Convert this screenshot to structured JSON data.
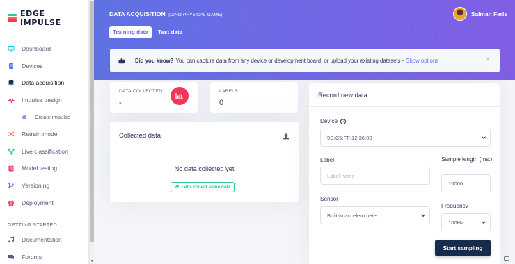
{
  "brand": {
    "name": "EDGE IMPULSE"
  },
  "sidebar": {
    "items": [
      {
        "label": "Dashboard",
        "icon": "monitor-icon",
        "color": "#11cdef"
      },
      {
        "label": "Devices",
        "icon": "devices-icon",
        "color": "#5e72e4"
      },
      {
        "label": "Data acquisition",
        "icon": "database-icon",
        "color": "#172b4d",
        "active": true
      },
      {
        "label": "Impulse design",
        "icon": "pulse-icon",
        "color": "#f5365c"
      },
      {
        "label": "Create impulse",
        "icon": "dot-icon",
        "color": "#5e72e4",
        "sub": true
      },
      {
        "label": "Retrain model",
        "icon": "shuffle-icon",
        "color": "#fb6340"
      },
      {
        "label": "Live classification",
        "icon": "network-icon",
        "color": "#2dce89"
      },
      {
        "label": "Model testing",
        "icon": "clipboard-icon",
        "color": "#f5365c"
      },
      {
        "label": "Versioning",
        "icon": "branch-icon",
        "color": "#5e72e4"
      },
      {
        "label": "Deployment",
        "icon": "gift-icon",
        "color": "#f5365c"
      }
    ],
    "section_heading": "GETTING STARTED",
    "more_items": [
      {
        "label": "Documentation",
        "icon": "music-icon",
        "color": "#525f7f"
      },
      {
        "label": "Forums",
        "icon": "chat-icon",
        "color": "#525f7f"
      }
    ]
  },
  "header": {
    "title": "DATA ACQUISITION",
    "project": "(DINO-PHYSICAL-GAME)",
    "tabs": [
      "Training data",
      "Test data"
    ],
    "user": "Salman Faris"
  },
  "tip": {
    "bold": "Did you know?",
    "text": "You can capture data from any device or development board, or upload your existing datasets -",
    "link": "Show options",
    "close": "×"
  },
  "stats": {
    "collected_label": "DATA COLLECTED",
    "collected_value": "-",
    "labels_label": "LABELS",
    "labels_value": "0"
  },
  "collected": {
    "title": "Collected data",
    "empty": "No data collected yet",
    "button": "Let's collect some data"
  },
  "record": {
    "title": "Record new data",
    "device_label": "Device",
    "device_value": "9C:C5:FF:12:36:39",
    "label_label": "Label",
    "label_placeholder": "Label name",
    "length_label": "Sample length (ms.)",
    "length_value": "10000",
    "sensor_label": "Sensor",
    "sensor_value": "Built-in accelerometer",
    "frequency_label": "Frequency",
    "frequency_value": "100Hz",
    "start_button": "Start sampling"
  },
  "colors": {
    "accent": "#5e72e4",
    "accent2": "#825ee4",
    "danger": "#f5365c",
    "success": "#2dce89",
    "dark": "#172b4d"
  }
}
